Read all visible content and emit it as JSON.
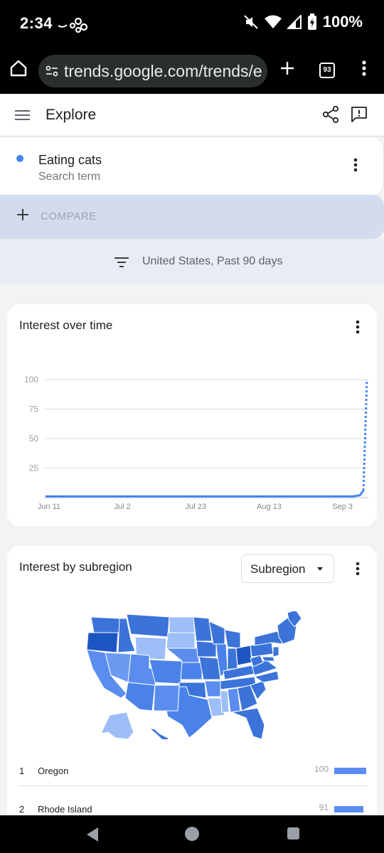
{
  "status": {
    "time": "2:34",
    "battery": "100%"
  },
  "browser": {
    "url": "trends.google.com/trends/e",
    "tab_count": "93"
  },
  "header": {
    "title": "Explore"
  },
  "term": {
    "name": "Eating cats",
    "subtitle": "Search term",
    "color": "#4285f4"
  },
  "compare": {
    "label": "COMPARE"
  },
  "filter": {
    "text": "United States, Past 90 days"
  },
  "interest_over_time": {
    "title": "Interest over time"
  },
  "interest_by_subregion": {
    "title": "Interest by subregion",
    "select_value": "Subregion",
    "rows": [
      {
        "rank": "1",
        "name": "Oregon",
        "value": "100",
        "fraction": 1.0
      },
      {
        "rank": "2",
        "name": "Rhode Island",
        "value": "91",
        "fraction": 0.91
      }
    ]
  },
  "chart_data": {
    "type": "line",
    "title": "Interest over time",
    "x_tick_labels": [
      "Jun 11",
      "Jul 2",
      "Jul 23",
      "Aug 13",
      "Sep 3"
    ],
    "y_tick_labels": [
      "100",
      "75",
      "50",
      "25"
    ],
    "ylim": [
      0,
      100
    ],
    "grid": true,
    "series": [
      {
        "color": "#4285f4",
        "x": [
          "Jun 10",
          "Jun 15",
          "Jun 20",
          "Jun 25",
          "Jun 30",
          "Jul 5",
          "Jul 10",
          "Jul 15",
          "Jul 20",
          "Jul 25",
          "Jul 30",
          "Aug 4",
          "Aug 9",
          "Aug 14",
          "Aug 19",
          "Aug 24",
          "Aug 29",
          "Sep 3",
          "Sep 6",
          "Sep 8",
          "Sep 9",
          "Sep 10"
        ],
        "values": [
          1,
          1,
          1,
          1,
          1,
          1,
          1,
          1,
          1,
          1,
          1,
          1,
          1,
          1,
          1,
          1,
          1,
          1,
          1,
          2,
          6,
          100
        ],
        "partial_from_index": 20
      }
    ]
  }
}
